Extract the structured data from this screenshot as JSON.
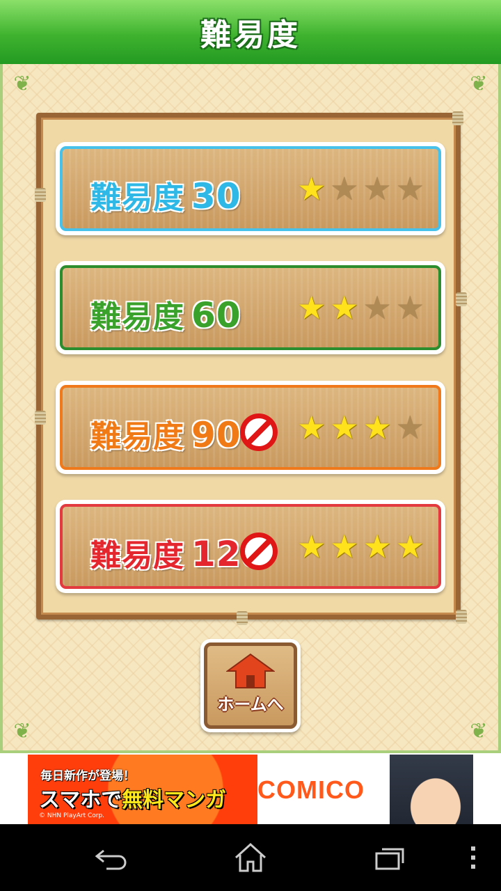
{
  "header": {
    "title": "難易度"
  },
  "levels": [
    {
      "prefix": "難易度",
      "number": "30",
      "color": "#2fb8e6",
      "border": "#47c1ea",
      "stars_on": 1,
      "stars_total": 4,
      "locked": false
    },
    {
      "prefix": "難易度",
      "number": "60",
      "color": "#3aa12b",
      "border": "#2c8d2e",
      "stars_on": 2,
      "stars_total": 4,
      "locked": false
    },
    {
      "prefix": "難易度",
      "number": "90",
      "color": "#f07a16",
      "border": "#f07a1b",
      "stars_on": 3,
      "stars_total": 4,
      "locked": true
    },
    {
      "prefix": "難易度",
      "number": "120",
      "color": "#e4272f",
      "border": "#e23a3e",
      "stars_on": 4,
      "stars_total": 4,
      "locked": true
    }
  ],
  "home_button": {
    "label": "ホームへ"
  },
  "ad": {
    "line1": "毎日新作が登場！",
    "line2_a": "スマホで",
    "line2_b": "無料マンガ",
    "brand": "COMICO",
    "copyright": "© NHN PlayArt Corp."
  },
  "colors": {
    "header_green": "#3fb32f",
    "wood_frame": "#9a6535",
    "star_on": "#ffe21c",
    "star_off": "#b08a55"
  },
  "navbar": {
    "icons": [
      "back-icon",
      "home-icon",
      "recent-apps-icon",
      "overflow-menu-icon"
    ]
  }
}
